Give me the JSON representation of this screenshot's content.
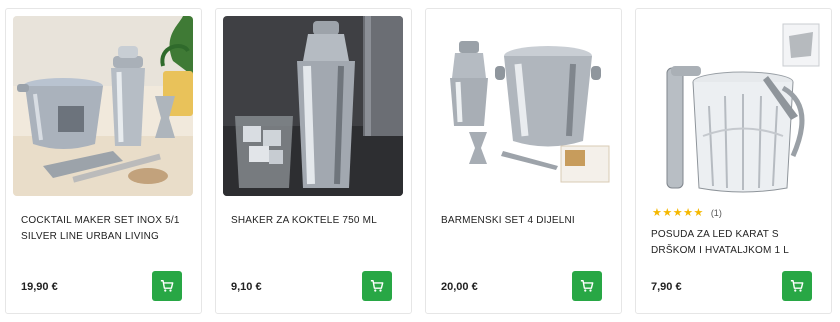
{
  "products": [
    {
      "title": "COCKTAIL MAKER SET INOX 5/1 SILVER LINE URBAN LIVING",
      "price": "19,90 €",
      "image_desc": "cocktail-set-photo"
    },
    {
      "title": "SHAKER ZA KOKTELE 750 ML",
      "price": "9,10 €",
      "image_desc": "shaker-photo"
    },
    {
      "title": "BARMENSKI SET 4 DIJELNI",
      "price": "20,00 €",
      "image_desc": "bar-set-photo"
    },
    {
      "title": "POSUDA ZA LED KARAT S DRŠKOM I HVATALJKOM 1 L",
      "price": "7,90 €",
      "rating_stars": "★★★★★",
      "rating_count": "(1)",
      "rating_value": 5,
      "image_desc": "ice-bucket-photo"
    }
  ],
  "colors": {
    "cart_button": "#28a745",
    "star": "#f5b800"
  },
  "icons": {
    "cart": "cart-icon",
    "star": "star-icon"
  }
}
